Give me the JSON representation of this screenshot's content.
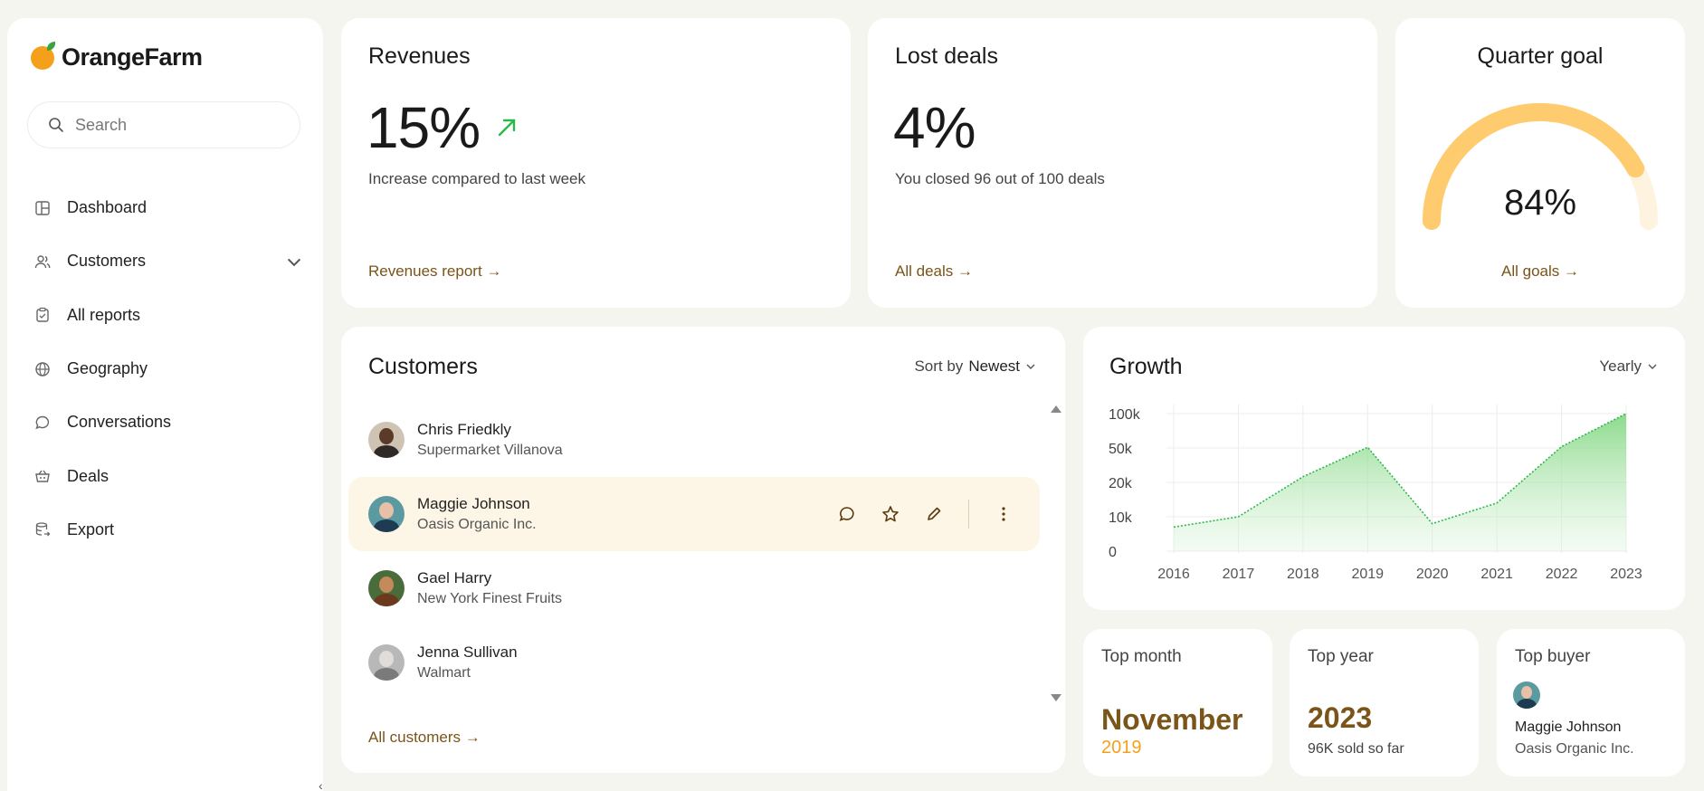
{
  "brand": {
    "name": "OrangeFarm"
  },
  "search": {
    "placeholder": "Search"
  },
  "nav": [
    {
      "label": "Dashboard",
      "icon": "dashboard-icon"
    },
    {
      "label": "Customers",
      "icon": "users-icon"
    },
    {
      "label": "All reports",
      "icon": "clipboard-icon"
    },
    {
      "label": "Geography",
      "icon": "globe-icon"
    },
    {
      "label": "Conversations",
      "icon": "chat-icon"
    },
    {
      "label": "Deals",
      "icon": "basket-icon"
    },
    {
      "label": "Export",
      "icon": "database-export-icon"
    }
  ],
  "revenues": {
    "title": "Revenues",
    "value": "15%",
    "subtitle": "Increase compared to last week",
    "link": "Revenues report →",
    "trend_color": "#2bb84a"
  },
  "lost_deals": {
    "title": "Lost deals",
    "value": "4%",
    "subtitle": "You closed 96 out of 100 deals",
    "link": "All deals →"
  },
  "quarter_goal": {
    "title": "Quarter goal",
    "value": "84%",
    "progress": 0.84,
    "link": "All goals →",
    "color": "#fecb6e"
  },
  "customers": {
    "title": "Customers",
    "sort_prefix": "Sort by",
    "sort_value": "Newest",
    "link": "All customers →",
    "items": [
      {
        "name": "Chris Friedkly",
        "company": "Supermarket Villanova"
      },
      {
        "name": "Maggie Johnson",
        "company": "Oasis Organic Inc."
      },
      {
        "name": "Gael Harry",
        "company": "New York Finest Fruits"
      },
      {
        "name": "Jenna Sullivan",
        "company": "Walmart"
      }
    ]
  },
  "growth": {
    "title": "Growth",
    "period": "Yearly",
    "chart_data": {
      "type": "area",
      "x": [
        "2016",
        "2017",
        "2018",
        "2019",
        "2020",
        "2021",
        "2022",
        "2023"
      ],
      "y_ticks": [
        "0",
        "10k",
        "20k",
        "50k",
        "100k"
      ],
      "series": [
        {
          "values": [
            "7k",
            "10k",
            "25k",
            "51k",
            "8k",
            "14k",
            "52k",
            "100k"
          ]
        }
      ],
      "grid": true,
      "color": "#2bb84a"
    }
  },
  "top_month": {
    "title": "Top month",
    "value": "November",
    "year": "2019"
  },
  "top_year": {
    "title": "Top year",
    "value": "2023",
    "desc": "96K sold so far"
  },
  "top_buyer": {
    "title": "Top buyer",
    "name": "Maggie Johnson",
    "company": "Oasis Organic Inc."
  }
}
